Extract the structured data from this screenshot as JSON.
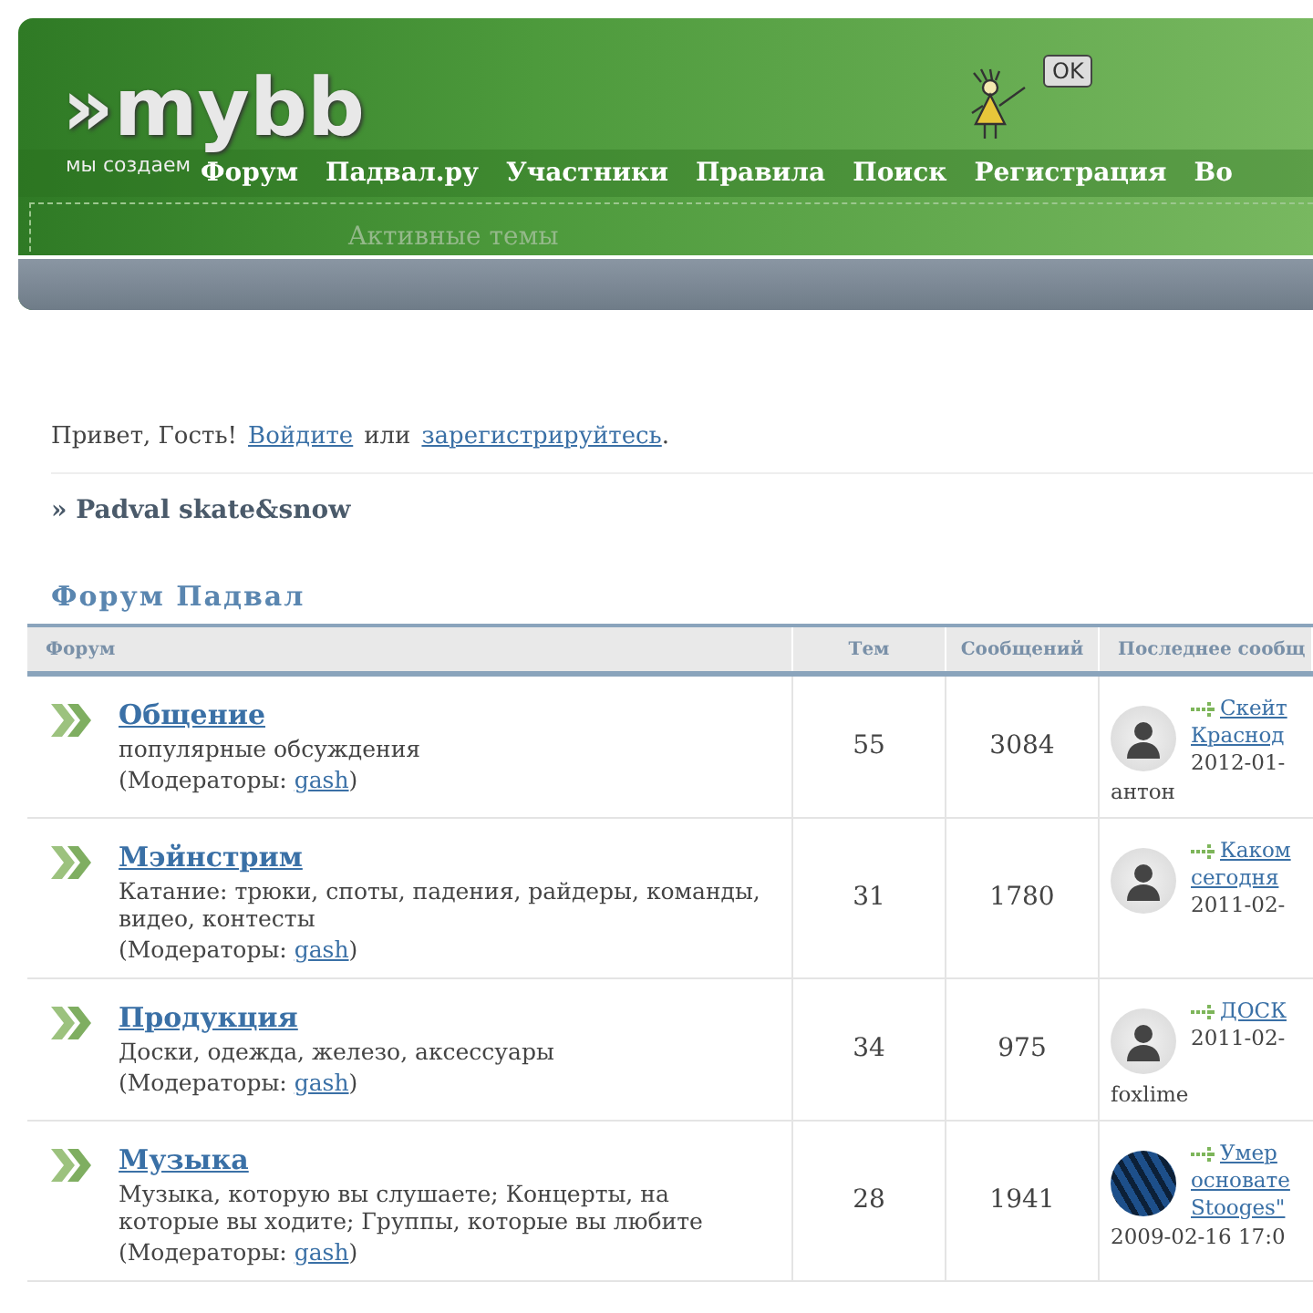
{
  "header": {
    "logo_mark": "»",
    "logo": "mybb",
    "tagline": "мы создаем",
    "badge": "OK",
    "nav": [
      "Форум",
      "Падвал.ру",
      "Участники",
      "Правила",
      "Поиск",
      "Регистрация",
      "Во"
    ],
    "active_topics": "Активные темы"
  },
  "welcome": {
    "greeting": "Привет, Гость!",
    "login": "Войдите",
    "or": "или",
    "register": "зарегистрируйтесь",
    "end": "."
  },
  "breadcrumb": "» Padval skate&snow",
  "category": "Форум Падвал",
  "table": {
    "columns": [
      "Форум",
      "Тем",
      "Сообщений",
      "Последнее сообщ"
    ],
    "rows": [
      {
        "title": "Общение",
        "description": "популярные обсуждения",
        "moderators_label": "(Модераторы:",
        "moderator": "gash",
        "close": ")",
        "topics": "55",
        "posts": "3084",
        "last": {
          "kind": "default",
          "topic_lines": [
            "Скейт",
            "Краснод"
          ],
          "date": "2012-01-",
          "author": "антон"
        }
      },
      {
        "title": "Мэйнстрим",
        "description": "Катание: трюки, споты, падения, райдеры, команды, видео, контесты",
        "moderators_label": "(Модераторы:",
        "moderator": "gash",
        "close": ")",
        "topics": "31",
        "posts": "1780",
        "last": {
          "kind": "default",
          "topic_lines": [
            "Каком",
            "сегодня"
          ],
          "date": "2011-02-"
        }
      },
      {
        "title": "Продукция",
        "description": "Доски, одежда, железо, аксессуары",
        "moderators_label": "(Модераторы:",
        "moderator": "gash",
        "close": ")",
        "topics": "34",
        "posts": "975",
        "last": {
          "kind": "default",
          "topic_lines": [
            "ДОСК"
          ],
          "date": "2011-02-",
          "author": "foxlime"
        }
      },
      {
        "title": "Музыка",
        "description": "Музыка, которую вы слушаете; Концерты, на которые вы ходите; Группы, которые вы любите",
        "moderators_label": "(Модераторы:",
        "moderator": "gash",
        "close": ")",
        "topics": "28",
        "posts": "1941",
        "last": {
          "kind": "photo",
          "topic_lines": [
            "Умер",
            "основате",
            "Stooges\""
          ],
          "date": "2009-02-16 17:0"
        }
      }
    ]
  }
}
